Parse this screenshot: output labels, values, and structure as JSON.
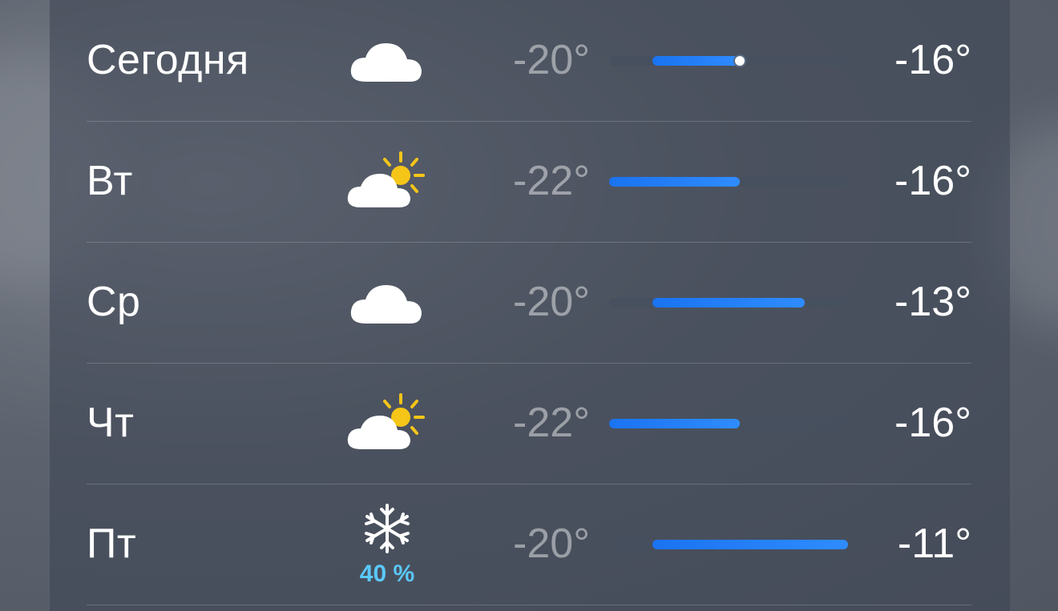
{
  "forecast": {
    "range": {
      "min": -22,
      "max": -11
    },
    "rows": [
      {
        "day": "Сегодня",
        "icon": "cloud-icon",
        "precip": "",
        "low_label": "-20°",
        "high_label": "-16°",
        "low": -20,
        "high": -16,
        "current": -16
      },
      {
        "day": "Вт",
        "icon": "partly-sunny-icon",
        "precip": "",
        "low_label": "-22°",
        "high_label": "-16°",
        "low": -22,
        "high": -16
      },
      {
        "day": "Ср",
        "icon": "cloud-icon",
        "precip": "",
        "low_label": "-20°",
        "high_label": "-13°",
        "low": -20,
        "high": -13
      },
      {
        "day": "Чт",
        "icon": "partly-sunny-icon",
        "precip": "",
        "low_label": "-22°",
        "high_label": "-16°",
        "low": -22,
        "high": -16
      },
      {
        "day": "Пт",
        "icon": "snowflake-icon",
        "precip": "40 %",
        "low_label": "-20°",
        "high_label": "-11°",
        "low": -20,
        "high": -11
      }
    ]
  },
  "colors": {
    "bar_fill": "#1a73f0",
    "precip_text": "#5ac8fa",
    "sun": "#f5c518"
  }
}
